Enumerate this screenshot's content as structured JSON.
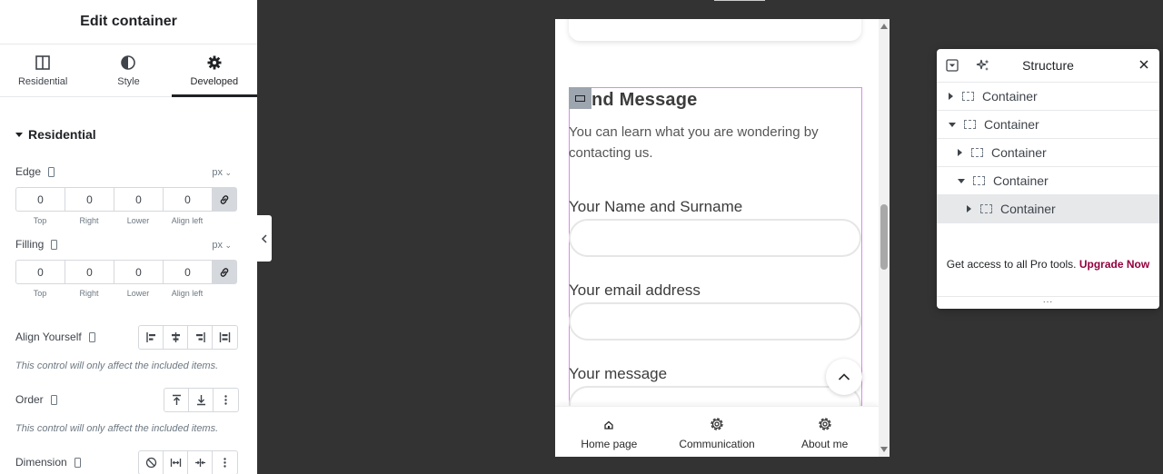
{
  "panel": {
    "title": "Edit container",
    "tabs": [
      {
        "label": "Residential",
        "icon": "layout-icon"
      },
      {
        "label": "Style",
        "icon": "half-circle-icon"
      },
      {
        "label": "Developed",
        "icon": "gear-icon",
        "active": true
      }
    ],
    "section_title": "Residential",
    "edge": {
      "label": "Edge",
      "unit": "px",
      "values": [
        "0",
        "0",
        "0",
        "0"
      ],
      "sides": [
        "Top",
        "Right",
        "Lower",
        "Align left"
      ]
    },
    "filling": {
      "label": "Filling",
      "unit": "px",
      "values": [
        "0",
        "0",
        "0",
        "0"
      ],
      "sides": [
        "Top",
        "Right",
        "Lower",
        "Align left"
      ]
    },
    "align_yourself": {
      "label": "Align Yourself",
      "hint": "This control will only affect the included items."
    },
    "order": {
      "label": "Order",
      "hint": "This control will only affect the included items."
    },
    "dimension": {
      "label": "Dimension"
    }
  },
  "preview": {
    "title_partial": "nd Message",
    "text": "You can learn what you are wondering by contacting us.",
    "fields": [
      {
        "label": "Your Name and Surname"
      },
      {
        "label": "Your email address"
      },
      {
        "label": "Your message"
      }
    ],
    "nav": [
      {
        "label": "Home page",
        "icon": "home-icon"
      },
      {
        "label": "Communication",
        "icon": "gear-icon"
      },
      {
        "label": "About me",
        "icon": "gear-icon"
      }
    ]
  },
  "structure": {
    "title": "Structure",
    "rows": [
      {
        "label": "Container",
        "depth": 0,
        "expanded": false
      },
      {
        "label": "Container",
        "depth": 0,
        "expanded": true
      },
      {
        "label": "Container",
        "depth": 1,
        "expanded": false
      },
      {
        "label": "Container",
        "depth": 1,
        "expanded": true
      },
      {
        "label": "Container",
        "depth": 2,
        "expanded": false,
        "selected": true
      }
    ],
    "promo_text": "Get access to all Pro tools.",
    "promo_link": "Upgrade Now",
    "more": "..."
  },
  "colors": {
    "canvas": "#333333",
    "accent_link": "#93003f",
    "selection": "#d88ce8"
  }
}
